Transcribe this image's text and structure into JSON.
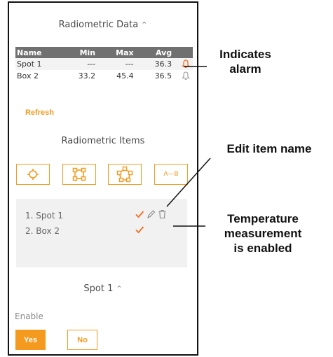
{
  "radiometric_data": {
    "header": "Radiometric Data",
    "columns": [
      "Name",
      "Min",
      "Max",
      "Avg"
    ],
    "rows": [
      {
        "name": "Spot 1",
        "min": "---",
        "max": "---",
        "avg": "36.3",
        "alarm": true
      },
      {
        "name": "Box 2",
        "min": "33.2",
        "max": "45.4",
        "avg": "36.5",
        "alarm": false
      }
    ],
    "refresh_label": "Refresh"
  },
  "radiometric_items": {
    "header": "Radiometric Items",
    "tools": [
      {
        "name": "spot-tool",
        "label": ""
      },
      {
        "name": "box-tool",
        "label": ""
      },
      {
        "name": "polygon-tool",
        "label": ""
      },
      {
        "name": "delta-tool",
        "label": "A—B"
      }
    ],
    "items": [
      {
        "label": "1. Spot 1",
        "enabled": true,
        "editable": true
      },
      {
        "label": "2. Box 2",
        "enabled": true,
        "editable": false
      }
    ]
  },
  "spot_section": {
    "header": "Spot 1",
    "enable_label": "Enable",
    "yes_label": "Yes",
    "no_label": "No",
    "selected": "Yes"
  },
  "callouts": {
    "alarm": "Indicates\nalarm",
    "edit": "Edit item name",
    "temperature": "Temperature\nmeasurement\nis enabled"
  },
  "colors": {
    "accent": "#f39a1f",
    "table_header": "#707070",
    "alarm_bell": "#f36b1f"
  }
}
